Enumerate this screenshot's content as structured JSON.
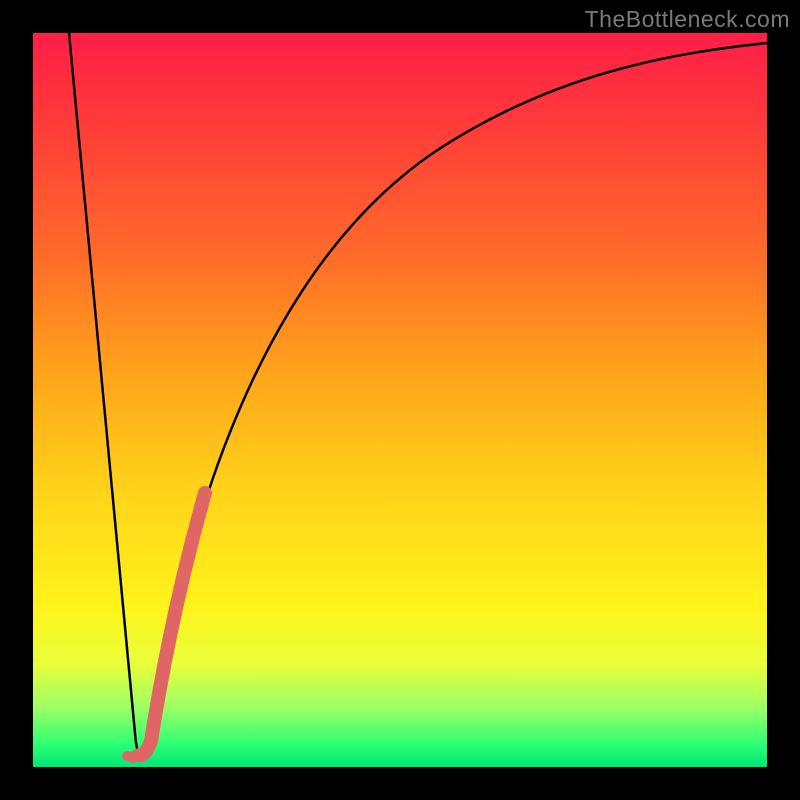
{
  "watermark": "TheBottleneck.com",
  "chart_data": {
    "type": "line",
    "title": "",
    "xlabel": "",
    "ylabel": "",
    "xlim": [
      0,
      100
    ],
    "ylim": [
      0,
      100
    ],
    "series": [
      {
        "name": "bottleneck-curve",
        "x": [
          0,
          3,
          6,
          9,
          12,
          13,
          14,
          15,
          16,
          17,
          19,
          22,
          26,
          32,
          40,
          50,
          62,
          76,
          90,
          100
        ],
        "y": [
          100,
          80,
          60,
          40,
          12,
          5,
          1,
          0,
          1,
          4,
          16,
          34,
          52,
          66,
          77,
          84,
          89,
          92,
          93.5,
          94.5
        ]
      },
      {
        "name": "highlight-segment",
        "x": [
          14.5,
          22.5
        ],
        "y": [
          1,
          36
        ]
      }
    ],
    "gradient_stops": [
      {
        "pos": 0,
        "color": "#ff1e46"
      },
      {
        "pos": 50,
        "color": "#ffd21a"
      },
      {
        "pos": 90,
        "color": "#9bff66"
      },
      {
        "pos": 100,
        "color": "#00e676"
      }
    ]
  }
}
